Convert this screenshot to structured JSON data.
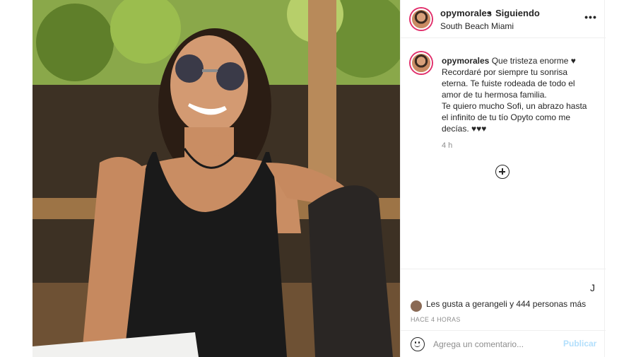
{
  "post": {
    "photo": {
      "description_icon": "post-photo"
    }
  },
  "header": {
    "username": "opymorales",
    "separator": "•",
    "follow_status": "Siguiendo",
    "location": "South Beach Miami",
    "more_icon": "more-options-icon",
    "more_glyph": "•••"
  },
  "caption": {
    "username": "opymorales",
    "text_lines": [
      "Que tristeza enorme ♥",
      "Recordaré por siempre tu sonrisa",
      "eterna. Te fuiste rodeada de todo el",
      "amor de tu hermosa familia.",
      "Te quiero mucho Sofi, un abrazo hasta",
      "el infinito de tu tío Opyto como me",
      "decías. ♥♥♥"
    ],
    "time": "4 h"
  },
  "likes": {
    "text": "Les gusta a gerangeli y 444 personas más",
    "bookmark_glyph": "J"
  },
  "timestamp": "HACE 4 HORAS",
  "comment": {
    "placeholder": "Agrega un comentario...",
    "publish_label": "Publicar"
  },
  "colors": {
    "link": "#b2dffc",
    "secondary_text": "#8e8e8e",
    "border": "#efefef",
    "story_ring": "#e1306c"
  }
}
